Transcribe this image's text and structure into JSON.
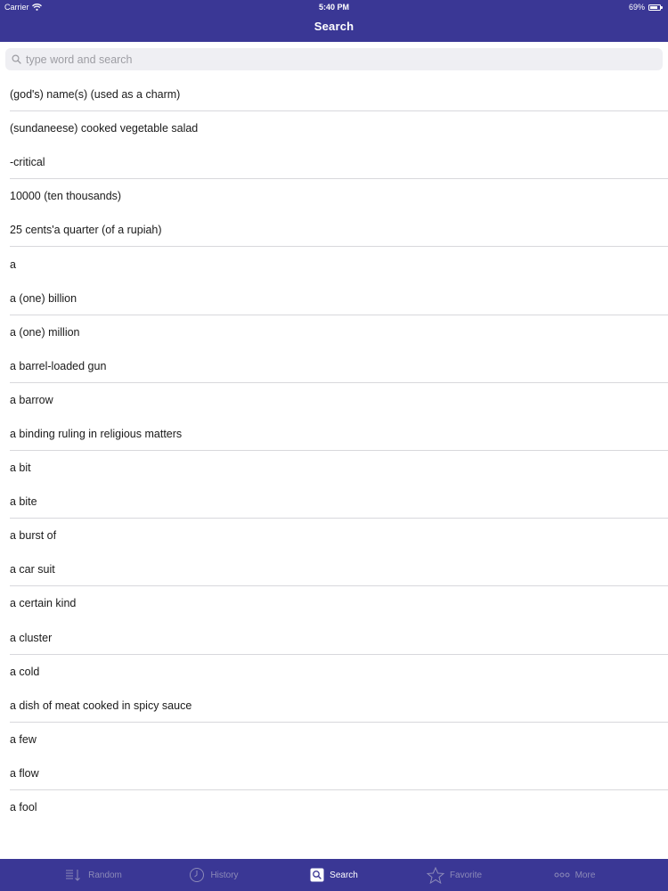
{
  "status_bar": {
    "carrier": "Carrier",
    "time": "5:40 PM",
    "battery": "69%"
  },
  "nav": {
    "title": "Search"
  },
  "search": {
    "placeholder": "type word and search",
    "value": ""
  },
  "colors": {
    "brand": "#3a3795",
    "tab_inactive": "#8c8ab8",
    "tab_active": "#ffffff"
  },
  "words": [
    "(god's) name(s) (used as a charm)",
    "(sundaneese) cooked vegetable salad",
    "-critical",
    "10000 (ten thousands)",
    "25 cents'a quarter (of a rupiah)",
    "a",
    "a (one) billion",
    "a (one) million",
    "a barrel-loaded gun",
    "a barrow",
    "a binding ruling in religious matters",
    "a bit",
    "a bite",
    "a burst of",
    "a car suit",
    "a certain kind",
    "a cluster",
    "a cold",
    "a dish of meat cooked in spicy sauce",
    "a few",
    "a flow",
    "a fool"
  ],
  "tabs": [
    {
      "label": "Random",
      "icon": "random-list-icon",
      "active": false
    },
    {
      "label": "History",
      "icon": "history-clock-icon",
      "active": false
    },
    {
      "label": "Search",
      "icon": "search-tab-icon",
      "active": true
    },
    {
      "label": "Favorite",
      "icon": "star-icon",
      "active": false
    },
    {
      "label": "More",
      "icon": "more-dots-icon",
      "active": false
    }
  ]
}
